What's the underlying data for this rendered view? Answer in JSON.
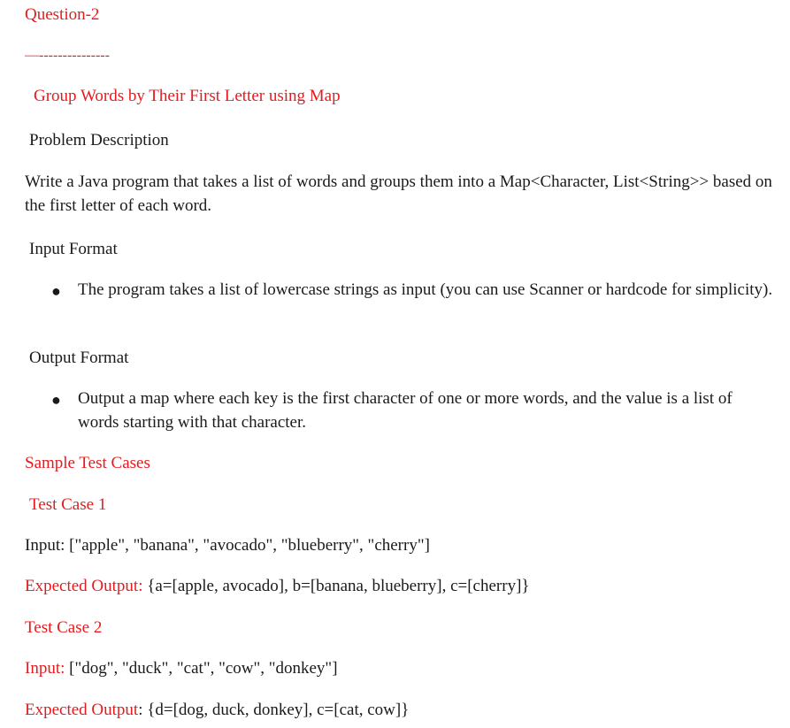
{
  "question_label": "Question-2",
  "separator": "—---------------",
  "title": "Group Words by Their First Letter using Map",
  "problem_description": {
    "heading": "Problem Description",
    "text": "Write a Java program that takes a list of words and groups them into a Map<Character, List<String>> based on the first letter of each word."
  },
  "input_format": {
    "heading": "Input Format",
    "bullets": [
      "The program takes a list of lowercase strings as input (you can use Scanner or hardcode for simplicity)."
    ]
  },
  "output_format": {
    "heading": "Output Format",
    "bullets": [
      "Output a map where each key is the first character of one or more words, and the value is a list of words starting with that character."
    ]
  },
  "sample_tests_heading": "Sample Test Cases",
  "test_cases": [
    {
      "heading": "Test Case 1",
      "input_label": "Input:",
      "input_value": " [\"apple\", \"banana\", \"avocado\", \"blueberry\", \"cherry\"]",
      "output_label": "Expected Output:",
      "output_value": " {a=[apple, avocado], b=[banana, blueberry], c=[cherry]}"
    },
    {
      "heading": "Test Case 2",
      "input_label": "Input:",
      "input_value": " [\"dog\", \"duck\", \"cat\", \"cow\", \"donkey\"]",
      "output_label": "Expected Output",
      "output_colon": ":",
      "output_value": " {d=[dog, duck, donkey], c=[cat, cow]}"
    }
  ],
  "colors": {
    "accent": "#e8191c",
    "text": "#1a1a1a",
    "background": "#ffffff"
  }
}
